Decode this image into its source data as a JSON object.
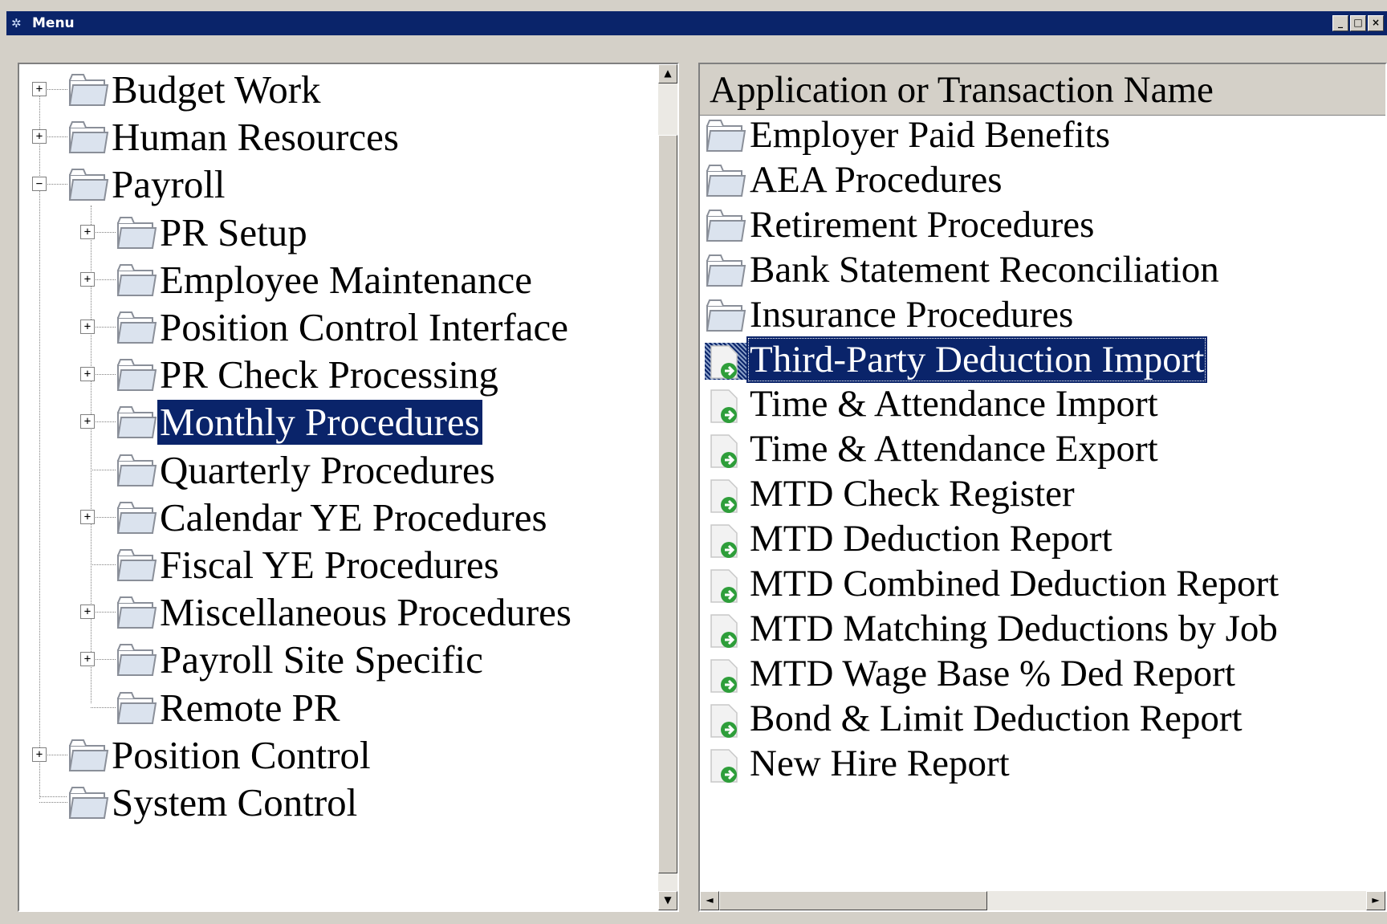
{
  "window": {
    "title": "Menu",
    "minimize_glyph": "_",
    "maximize_glyph": "□",
    "close_glyph": "×"
  },
  "tree": {
    "items": [
      {
        "label": "Budget Work",
        "state": "collapsed"
      },
      {
        "label": "Human Resources",
        "state": "collapsed"
      },
      {
        "label": "Payroll",
        "state": "expanded"
      },
      {
        "label": "PR Setup",
        "state": "collapsed"
      },
      {
        "label": "Employee Maintenance",
        "state": "collapsed"
      },
      {
        "label": "Position Control Interface",
        "state": "collapsed"
      },
      {
        "label": "PR Check Processing",
        "state": "collapsed"
      },
      {
        "label": "Monthly Procedures",
        "state": "collapsed",
        "selected": true
      },
      {
        "label": "Quarterly Procedures",
        "state": "leaf"
      },
      {
        "label": "Calendar YE Procedures",
        "state": "collapsed"
      },
      {
        "label": "Fiscal YE Procedures",
        "state": "leaf"
      },
      {
        "label": "Miscellaneous Procedures",
        "state": "collapsed"
      },
      {
        "label": "Payroll Site Specific",
        "state": "collapsed"
      },
      {
        "label": "Remote PR",
        "state": "leaf"
      },
      {
        "label": "Position Control",
        "state": "collapsed"
      },
      {
        "label": "System Control",
        "state": "leaf"
      }
    ]
  },
  "list": {
    "header": "Application or Transaction Name",
    "items": [
      {
        "label": "Employer Paid Benefits",
        "icon": "folder-icon"
      },
      {
        "label": "AEA Procedures",
        "icon": "folder-icon"
      },
      {
        "label": "Retirement Procedures",
        "icon": "folder-icon"
      },
      {
        "label": "Bank Statement Reconciliation",
        "icon": "folder-icon"
      },
      {
        "label": "Insurance Procedures",
        "icon": "folder-icon"
      },
      {
        "label": "Third-Party Deduction Import",
        "icon": "run-program-icon",
        "selected": true
      },
      {
        "label": "Time & Attendance Import",
        "icon": "run-program-icon"
      },
      {
        "label": "Time & Attendance Export",
        "icon": "run-program-icon"
      },
      {
        "label": "MTD Check Register",
        "icon": "run-program-icon"
      },
      {
        "label": "MTD Deduction Report",
        "icon": "run-program-icon"
      },
      {
        "label": "MTD Combined Deduction Report",
        "icon": "run-program-icon"
      },
      {
        "label": "MTD Matching Deductions by Job",
        "icon": "run-program-icon"
      },
      {
        "label": "MTD Wage Base % Ded Report",
        "icon": "run-program-icon"
      },
      {
        "label": "Bond & Limit Deduction Report",
        "icon": "run-program-icon"
      },
      {
        "label": "New Hire Report",
        "icon": "run-program-icon"
      }
    ]
  },
  "colors": {
    "selection": "#0a246a",
    "title_bar": "#0a246a",
    "chrome": "#d4d0c8",
    "run_icon": "#2e9e3a"
  },
  "scrollbar_glyphs": {
    "up": "▲",
    "down": "▼",
    "left": "◄",
    "right": "►"
  }
}
